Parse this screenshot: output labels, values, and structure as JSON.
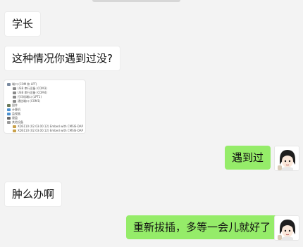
{
  "messages": {
    "m1": "学长",
    "m2": "这种情况你遇到过没?",
    "m3": "遇到过",
    "m4": "肿么办啊",
    "m5": "重新拔插，多等一会儿就好了"
  },
  "screenshot": {
    "rows": [
      "端口 (COM 和 LPT)",
      "USB 串行设备 (COM3)",
      "USB 串行设备 (COM4)",
      "打印机端口 (LPT1)",
      "通信端口 (COM1)",
      "固件",
      "计算机",
      "监视器",
      "键盘",
      "其他设备",
      "XDS110 (02.03.00.12) Embed with CMSIS-DAP",
      "XDS110 (02.03.00.12) Embed with CMSIS-DAP"
    ]
  },
  "colors": {
    "incoming_bubble": "#ffffff",
    "outgoing_bubble": "#95ec69",
    "background": "#f3f3f3"
  },
  "icons": {
    "avatar": "cartoon-girl-avatar"
  }
}
